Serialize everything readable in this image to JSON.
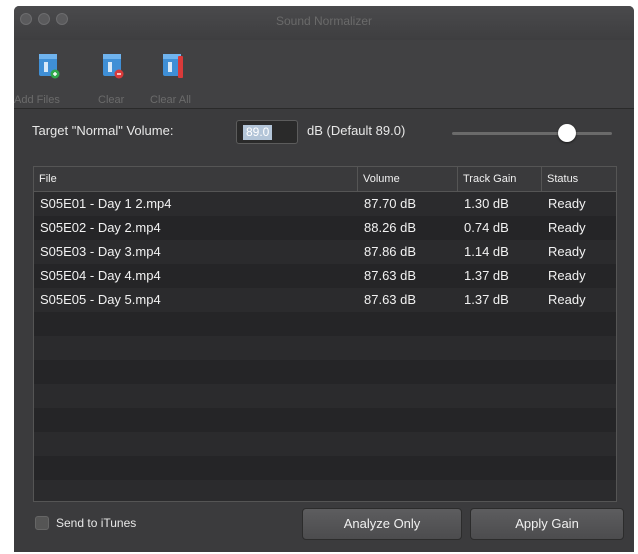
{
  "window": {
    "title": "Sound Normalizer"
  },
  "toolbar": {
    "add_label": "Add Files",
    "clear_label": "Clear",
    "clear_all_label": "Clear All"
  },
  "volume": {
    "label": "Target \"Normal\" Volume:",
    "value": "89.0",
    "default_text": "dB (Default 89.0)"
  },
  "table": {
    "columns": [
      "File",
      "Volume",
      "Track Gain",
      "Status"
    ],
    "rows": [
      {
        "file": "S05E01 - Day 1 2.mp4",
        "volume": "87.70 dB",
        "gain": "1.30 dB",
        "status": "Ready"
      },
      {
        "file": "S05E02 - Day 2.mp4",
        "volume": "88.26 dB",
        "gain": "0.74 dB",
        "status": "Ready"
      },
      {
        "file": "S05E03 - Day 3.mp4",
        "volume": "87.86 dB",
        "gain": "1.14 dB",
        "status": "Ready"
      },
      {
        "file": "S05E04 - Day 4.mp4",
        "volume": "87.63 dB",
        "gain": "1.37 dB",
        "status": "Ready"
      },
      {
        "file": "S05E05 - Day 5.mp4",
        "volume": "87.63 dB",
        "gain": "1.37 dB",
        "status": "Ready"
      }
    ]
  },
  "footer": {
    "send_to_itunes_label": "Send to iTunes",
    "analyze_only_label": "Analyze Only",
    "apply_gain_label": "Apply Gain"
  }
}
